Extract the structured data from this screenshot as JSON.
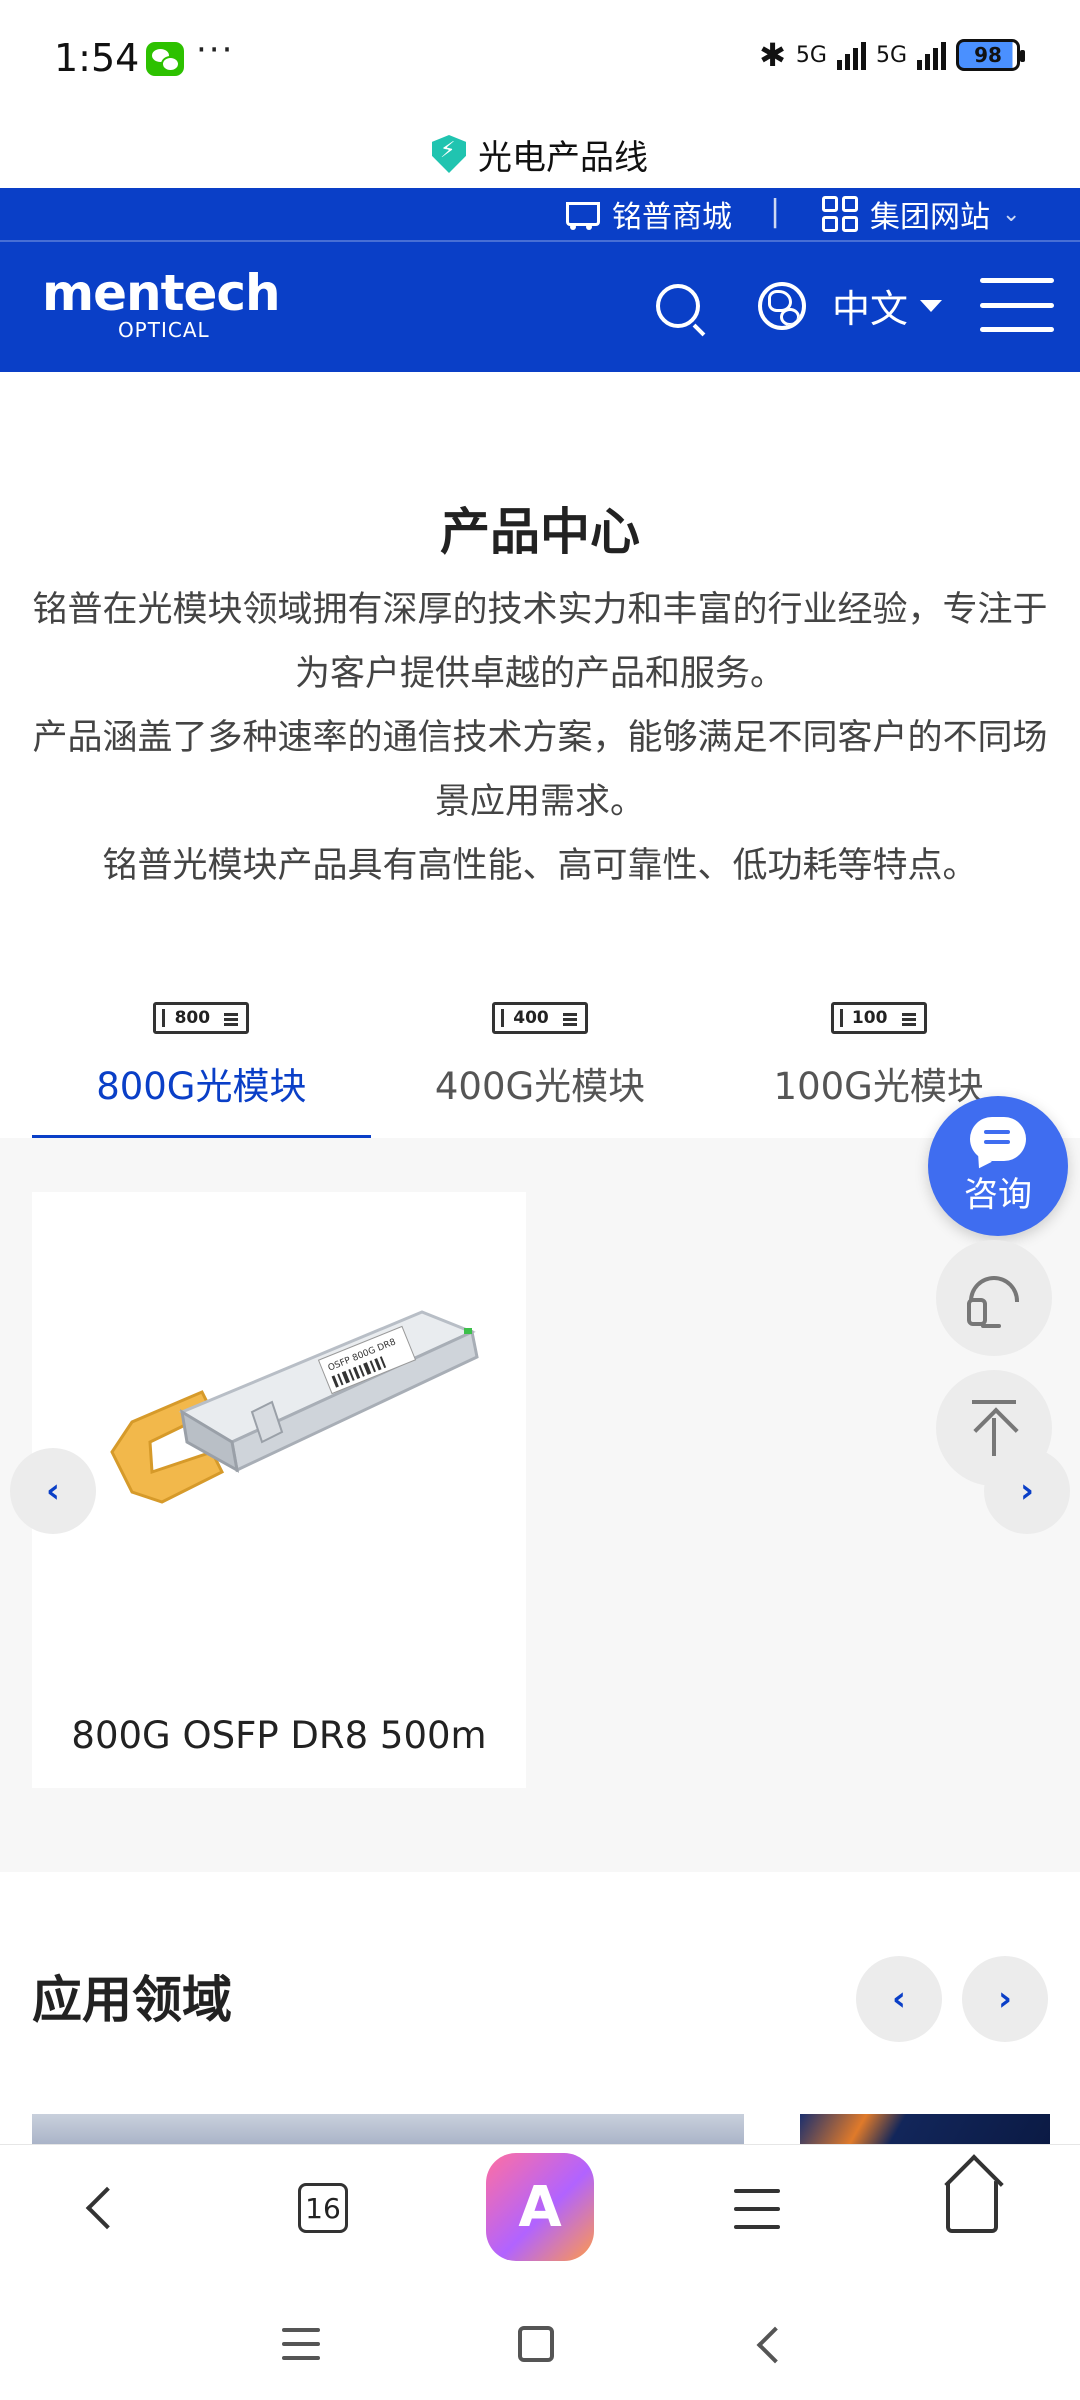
{
  "status_bar": {
    "time": "1:54",
    "more": "···",
    "network_1": "5G",
    "network_2": "5G",
    "battery": "98",
    "icons": [
      "wechat-icon",
      "bluetooth-icon",
      "signal-icon",
      "battery-icon"
    ]
  },
  "page_title": "光电产品线",
  "header": {
    "mall_label": "铭普商城",
    "separator": "|",
    "group_label": "集团网站",
    "logo_word": "mentech",
    "logo_sub": "OPTICAL",
    "language": "中文",
    "brand_color": "#0a3fc7"
  },
  "product_center": {
    "title": "产品中心",
    "intro_1": "铭普在光模块领域拥有深厚的技术实力和丰富的行业经验，专注于为客户提供卓越的产品和服务。",
    "intro_2": "产品涵盖了多种速率的通信技术方案，能够满足不同客户的不同场景应用需求。",
    "intro_3": "铭普光模块产品具有高性能、高可靠性、低功耗等特点。",
    "tabs": [
      {
        "icon_text": "800",
        "label": "800G光模块",
        "active": true
      },
      {
        "icon_text": "400",
        "label": "400G光模块",
        "active": false
      },
      {
        "icon_text": "100",
        "label": "100G光模块",
        "active": false
      }
    ],
    "card": {
      "name": "800G OSFP DR8 500m",
      "module_text": "OSFP 800G DR8"
    },
    "prev_arrow": "‹",
    "next_arrow": "›"
  },
  "floating": {
    "consult_label": "咨询"
  },
  "applications": {
    "title": "应用领域",
    "prev_arrow": "‹",
    "next_arrow": "›"
  },
  "browser_bar": {
    "tab_count": "16",
    "app_letter": "A"
  }
}
